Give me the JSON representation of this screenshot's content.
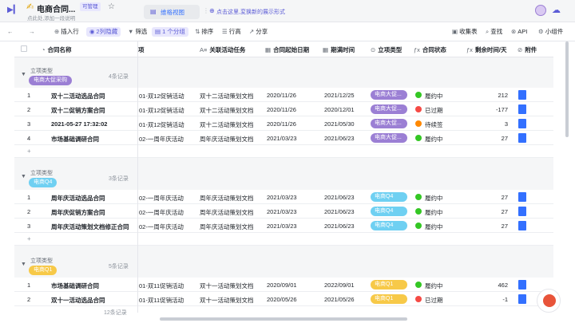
{
  "app": {
    "doc_emoji": "✍",
    "title": "电商合同...",
    "role": "可管理",
    "description": "点此处,添加一段说明",
    "view_tab": "维格视图",
    "add_view": "点击这里,変换新的展示形式"
  },
  "toolbar": {
    "insert_row": "插入行",
    "hidden_cols": "2列隐藏",
    "filter": "筛选",
    "group": "1 个分组",
    "sort": "排序",
    "row_height": "行高",
    "share": "分享",
    "favorites": "收集表",
    "search": "查找",
    "api": "API",
    "widgets": "小组件"
  },
  "columns": {
    "name": "合同名称",
    "activity": "项",
    "task": "关联活动任务",
    "start": "合同起始日期",
    "end": "期满时间",
    "type": "立项类型",
    "status": "合同状态",
    "days": "剩余时间/天",
    "attachment": "附件"
  },
  "colors": {
    "accent": "#5b5bd6",
    "purple": "#9b7fd4",
    "cyan": "#6fd0f2",
    "yellow": "#f7c948",
    "green": "#34c724",
    "red": "#f54a45",
    "orange": "#ff8800"
  },
  "groups": [
    {
      "type_label": "立项类型",
      "tag": "电商大促采购",
      "count": "4条记录",
      "rows": [
        {
          "idx": "1",
          "name": "双十二活动选品合同",
          "activity": "01-双12促销活动",
          "task": "双十二活动策划文档",
          "start": "2020/11/26",
          "end": "2021/12/25",
          "tag": "电商大促...",
          "status": "履约中",
          "days": "212"
        },
        {
          "idx": "2",
          "name": "双十二促销方案合同",
          "activity": "01-双12促销活动",
          "task": "双十二活动策划文档",
          "start": "2020/11/26",
          "end": "2020/12/01",
          "tag": "电商大促...",
          "status": "已过期",
          "days": "-177"
        },
        {
          "idx": "3",
          "name": "2021-05-27 17:32:02",
          "activity": "01-双12促销活动",
          "task": "双十二活动策划文档",
          "start": "2020/11/26",
          "end": "2021/05/30",
          "tag": "电商大促...",
          "status": "待续签",
          "days": "3"
        },
        {
          "idx": "4",
          "name": "市场基础调研合同",
          "activity": "02-一周年庆活动",
          "task": "周年庆活动策划文档",
          "start": "2021/03/23",
          "end": "2021/06/23",
          "tag": "电商大促...",
          "status": "履约中",
          "days": "27"
        }
      ]
    },
    {
      "type_label": "立项类型",
      "tag": "电商Q4",
      "count": "3条记录",
      "rows": [
        {
          "idx": "1",
          "name": "周年庆活动选品合同",
          "activity": "02-一周年庆活动",
          "task": "周年庆活动策划文档",
          "start": "2021/03/23",
          "end": "2021/06/23",
          "tag": "电商Q4",
          "status": "履约中",
          "days": "27"
        },
        {
          "idx": "2",
          "name": "周年庆促销方案合同",
          "activity": "02-一周年庆活动",
          "task": "周年庆活动策划文档",
          "start": "2021/03/23",
          "end": "2021/06/23",
          "tag": "电商Q4",
          "status": "履约中",
          "days": "27"
        },
        {
          "idx": "3",
          "name": "周年庆活动策划文档修正合同",
          "activity": "02-一周年庆活动",
          "task": "周年庆活动策划文档",
          "start": "2021/03/23",
          "end": "2021/06/23",
          "tag": "电商Q4",
          "status": "履约中",
          "days": "27"
        }
      ]
    },
    {
      "type_label": "立项类型",
      "tag": "电商Q1",
      "count": "5条记录",
      "rows": [
        {
          "idx": "1",
          "name": "市场基础调研合同",
          "activity": "01-双11促销活动",
          "task": "双十一活动策划文档",
          "start": "2020/09/01",
          "end": "2022/09/01",
          "tag": "电商Q1",
          "status": "履约中",
          "days": "462"
        },
        {
          "idx": "2",
          "name": "双十一活动选品合同",
          "activity": "01-双11促销活动",
          "task": "双十一活动策划文档",
          "start": "2020/05/26",
          "end": "2021/05/26",
          "tag": "电商Q1",
          "status": "已过期",
          "days": "-1"
        }
      ]
    }
  ],
  "footer": {
    "count": "12条记录"
  }
}
